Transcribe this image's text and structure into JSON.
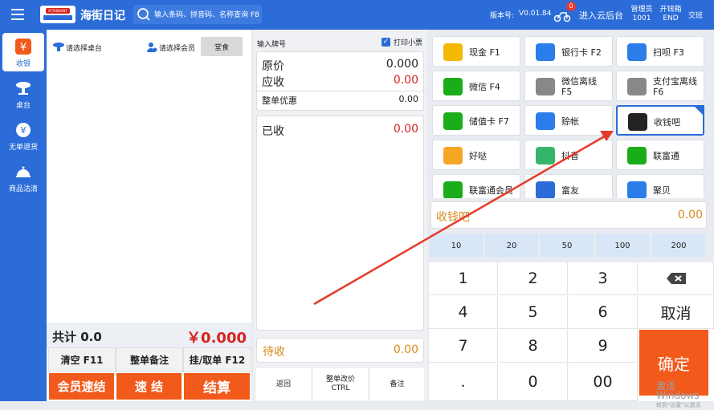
{
  "app": {
    "title": "海街日记",
    "logo": "ATTENDANT",
    "search_placeholder": "输入条码、拼音码、名称查询 F8",
    "version_label": "版本号:",
    "version": "V0.01.84",
    "notify_count": "0",
    "cloud_label": "进入云后台",
    "user_role": "管理员",
    "user_id": "1001",
    "shift_label": "开钱箱",
    "shift_key": "END",
    "handover": "交班"
  },
  "sidebar": [
    {
      "label": "收银",
      "icon": "yen-icon"
    },
    {
      "label": "桌台",
      "icon": "table-icon"
    },
    {
      "label": "无单退货",
      "icon": "refund-icon"
    },
    {
      "label": "商品沽清",
      "icon": "cloche-icon"
    }
  ],
  "left": {
    "select_table": "请选择桌台",
    "select_member": "请选择会员",
    "dine_in": "堂食",
    "total_label": "共计 0.0",
    "total_amount": "￥0.000",
    "clear": "清空 F11",
    "remark": "整单备注",
    "hold": "挂/取单 F12",
    "member_settle": "会员速结",
    "quick_settle": "速 结",
    "checkout": "结算"
  },
  "middle": {
    "plate_label": "输入牌号",
    "print_label": "打印小票",
    "original_label": "原价",
    "original_value": "0.000",
    "payable_label": "应收",
    "payable_value": "0.00",
    "discount_label": "整单优惠",
    "discount_value": "0.00",
    "received_label": "已收",
    "received_value": "0.00",
    "pending_label": "待收",
    "pending_value": "0.00",
    "back": "返回",
    "price_change": "整单改价",
    "price_change_key": "CTRL",
    "note": "备注"
  },
  "payments": [
    {
      "label": "现金 F1",
      "icon": "cash-icon",
      "color": "#f5b800"
    },
    {
      "label": "银行卡 F2",
      "icon": "bank-card-icon",
      "color": "#2b7de9"
    },
    {
      "label": "扫呗 F3",
      "icon": "saobei-icon",
      "color": "#2b7de9"
    },
    {
      "label": "微信 F4",
      "icon": "wechat-icon",
      "color": "#1aad19"
    },
    {
      "label": "微信离线",
      "label2": "F5",
      "icon": "wechat-offline-icon",
      "color": "#888888"
    },
    {
      "label": "支付宝离线",
      "label2": "F6",
      "icon": "alipay-offline-icon",
      "color": "#888888"
    },
    {
      "label": "储值卡 F7",
      "icon": "stored-card-icon",
      "color": "#1aad19"
    },
    {
      "label": "赊帐",
      "icon": "credit-icon",
      "color": "#2b7de9"
    },
    {
      "label": "收钱吧",
      "icon": "shouqianba-icon",
      "color": "#222222"
    },
    {
      "label": "好哒",
      "icon": "haoda-icon",
      "color": "#f5a623"
    },
    {
      "label": "抖音",
      "icon": "douyin-icon",
      "color": "#35b56b"
    },
    {
      "label": "联富通",
      "icon": "lianfutong-icon",
      "color": "#1aad19"
    },
    {
      "label": "联富通会员",
      "icon": "lianfutong-member-icon",
      "color": "#1aad19"
    },
    {
      "label": "富友",
      "icon": "fuyou-icon",
      "color": "#2b6cd8"
    },
    {
      "label": "聚贝",
      "icon": "jubei-icon",
      "color": "#2b7de9"
    }
  ],
  "pay_input": {
    "label": "收钱吧",
    "value": "0.00"
  },
  "quick_amounts": [
    "10",
    "20",
    "50",
    "100",
    "200"
  ],
  "keypad": {
    "keys": [
      "1",
      "2",
      "3",
      "4",
      "5",
      "6",
      "7",
      "8",
      "9",
      ".",
      "0",
      "00"
    ],
    "cancel": "取消",
    "confirm": "确定"
  },
  "watermark": {
    "line1": "激活 Windows",
    "line2": "转到\"设置\"以激活"
  }
}
